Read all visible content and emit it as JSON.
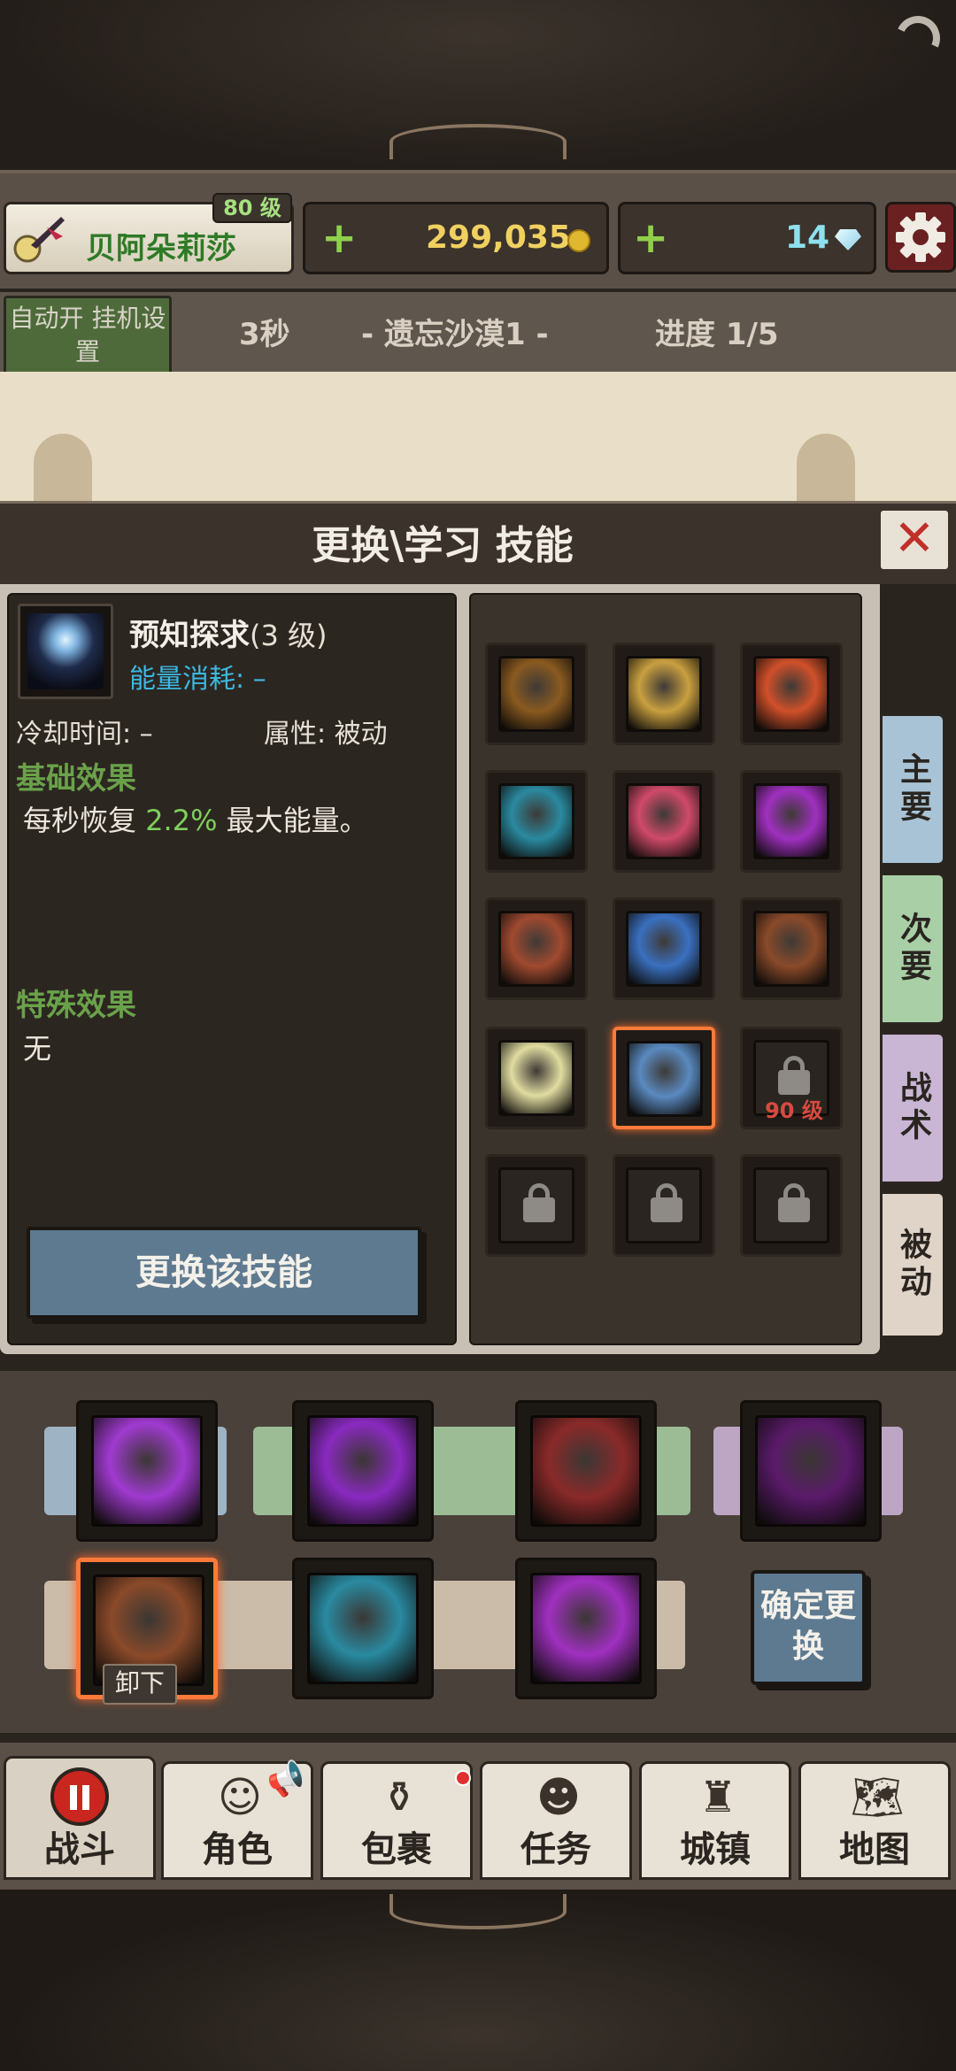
{
  "player": {
    "name": "贝阿朵莉莎",
    "level": "80 级"
  },
  "currency": {
    "gold": "299,035",
    "gems": "14",
    "plus": "+"
  },
  "status": {
    "auto_label": "自动开 挂机设置",
    "timer": "3秒",
    "location": "-  遗忘沙漠1  -",
    "progress": "进度 1/5"
  },
  "panel": {
    "title": "更换\\学习 技能",
    "close": "✕"
  },
  "skill_detail": {
    "name": "预知探求",
    "level": "(3 级)",
    "energy": "能量消耗: –",
    "cooldown": "冷却时间: –",
    "attribute": "属性: 被动",
    "basic_effect_title": "基础效果",
    "basic_effect_prefix": "每秒恢复",
    "basic_effect_value": "2.2%",
    "basic_effect_suffix": "最大能量。",
    "special_effect_title": "特殊效果",
    "special_effect_body": "无",
    "replace_button": "更换该技能"
  },
  "skill_grid": {
    "locked_level": "90 级",
    "slots": [
      {
        "icon": "bear-moon-icon",
        "color": "#8a5a20"
      },
      {
        "icon": "golden-shield-icon",
        "color": "#c9a040"
      },
      {
        "icon": "explosion-icon",
        "color": "#d0502a"
      },
      {
        "icon": "cyan-silhouette-icon",
        "color": "#2a8aa0"
      },
      {
        "icon": "pink-orb-icon",
        "color": "#d04a6a"
      },
      {
        "icon": "purple-hand-icon",
        "color": "#a030c0"
      },
      {
        "icon": "bone-claw-icon",
        "color": "#a04a30"
      },
      {
        "icon": "lightbeam-figure-icon",
        "color": "#3a70c0"
      },
      {
        "icon": "masked-warrior-icon",
        "color": "#8a4a2a"
      },
      {
        "icon": "light-burst-icon",
        "color": "#e0dca0"
      },
      {
        "icon": "foresight-orb-icon",
        "color": "#5a8ac0"
      },
      {
        "icon": "lock-icon",
        "color": "#2a2520"
      }
    ]
  },
  "tabs": {
    "main": "主要",
    "secondary": "次要",
    "tactics": "战术",
    "passive": "被动"
  },
  "tab_colors": {
    "main": "#a9c3d6",
    "secondary": "#a8cfa6",
    "tactics": "#c9b6d4",
    "passive": "#e0d4c8"
  },
  "loadout": {
    "unequip": "卸下",
    "confirm": "确定更换",
    "slots_row1": [
      {
        "icon": "purple-lightning-icon",
        "color": "#a03ad0"
      },
      {
        "icon": "purple-vortex-icon",
        "color": "#8a2ac0"
      },
      {
        "icon": "armored-knight-icon",
        "color": "#8a2a2a"
      },
      {
        "icon": "shadow-beast-icon",
        "color": "#5a1a6a"
      }
    ],
    "slots_row2": [
      {
        "icon": "masked-warrior-icon",
        "color": "#8a4a2a"
      },
      {
        "icon": "cyan-silhouette-icon",
        "color": "#2a8aa0"
      },
      {
        "icon": "purple-hand-icon",
        "color": "#a030c0"
      }
    ]
  },
  "nav": {
    "battle": "战斗",
    "character": "角色",
    "bag": "包裹",
    "quest": "任务",
    "town": "城镇",
    "map": "地图"
  }
}
